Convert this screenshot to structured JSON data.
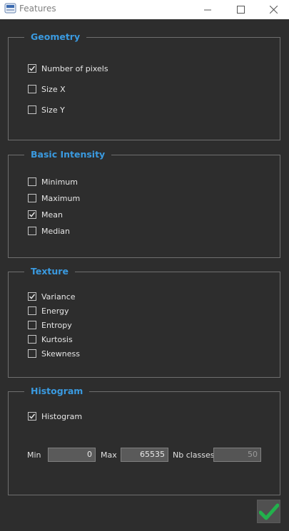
{
  "window": {
    "title": "Features",
    "app_icon": "app-logo-icon",
    "controls": [
      "minimize-icon",
      "maximize-icon",
      "close-icon"
    ]
  },
  "colors": {
    "background": "#2d2d2d",
    "group_title": "#3a9ae0",
    "check_mark": "#e6e6e6",
    "ok_check": "#22b14c"
  },
  "geometry": {
    "title": "Geometry",
    "items": [
      {
        "label": "Number of pixels",
        "checked": true
      },
      {
        "label": "Size X",
        "checked": false
      },
      {
        "label": "Size Y",
        "checked": false
      }
    ]
  },
  "basic_intensity": {
    "title": "Basic Intensity",
    "items": [
      {
        "label": "Minimum",
        "checked": false
      },
      {
        "label": "Maximum",
        "checked": false
      },
      {
        "label": "Mean",
        "checked": true
      },
      {
        "label": "Median",
        "checked": false
      }
    ]
  },
  "texture": {
    "title": "Texture",
    "items": [
      {
        "label": "Variance",
        "checked": true
      },
      {
        "label": "Energy",
        "checked": false
      },
      {
        "label": "Entropy",
        "checked": false
      },
      {
        "label": "Kurtosis",
        "checked": false
      },
      {
        "label": "Skewness",
        "checked": false
      }
    ]
  },
  "histogram": {
    "title": "Histogram",
    "items": [
      {
        "label": "Histogram",
        "checked": true
      }
    ],
    "min_label": "Min",
    "min_value": "0",
    "max_label": "Max",
    "max_value": "65535",
    "nb_classes_label": "Nb classes",
    "nb_classes_value": "50"
  },
  "ok_button": {
    "icon": "checkmark-icon"
  }
}
